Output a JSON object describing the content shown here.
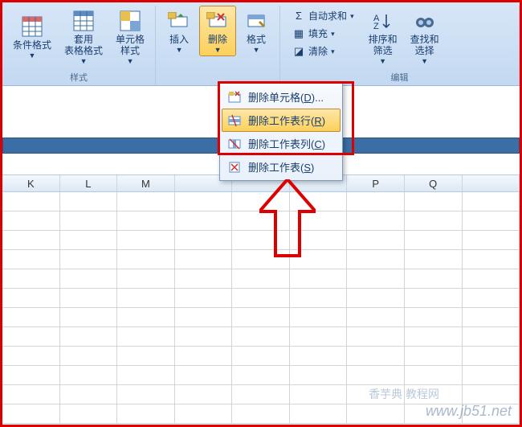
{
  "ribbon": {
    "groups": {
      "styles": {
        "label": "样式",
        "condFormat": "条件格式",
        "tableFormat": "套用\n表格格式",
        "cellStyle": "单元格\n样式"
      },
      "cells": {
        "insert": "插入",
        "delete": "删除",
        "format": "格式"
      },
      "editing": {
        "label": "编辑",
        "autosum": "自动求和",
        "fill": "填充",
        "clear": "清除",
        "sortFilter": "排序和\n筛选",
        "findSelect": "查找和\n选择"
      }
    }
  },
  "menu": {
    "deleteCells": {
      "text": "删除单元格",
      "key": "D",
      "suffix": "..."
    },
    "deleteRows": {
      "text": "删除工作表行",
      "key": "R"
    },
    "deleteCols": {
      "text": "删除工作表列",
      "key": "C"
    },
    "deleteSheet": {
      "text": "删除工作表",
      "key": "S"
    }
  },
  "columns": [
    "K",
    "L",
    "M",
    "",
    "",
    "",
    "P",
    "Q",
    ""
  ],
  "watermark": {
    "url": "www.jb51.net",
    "site": "香芋典 教程网"
  }
}
